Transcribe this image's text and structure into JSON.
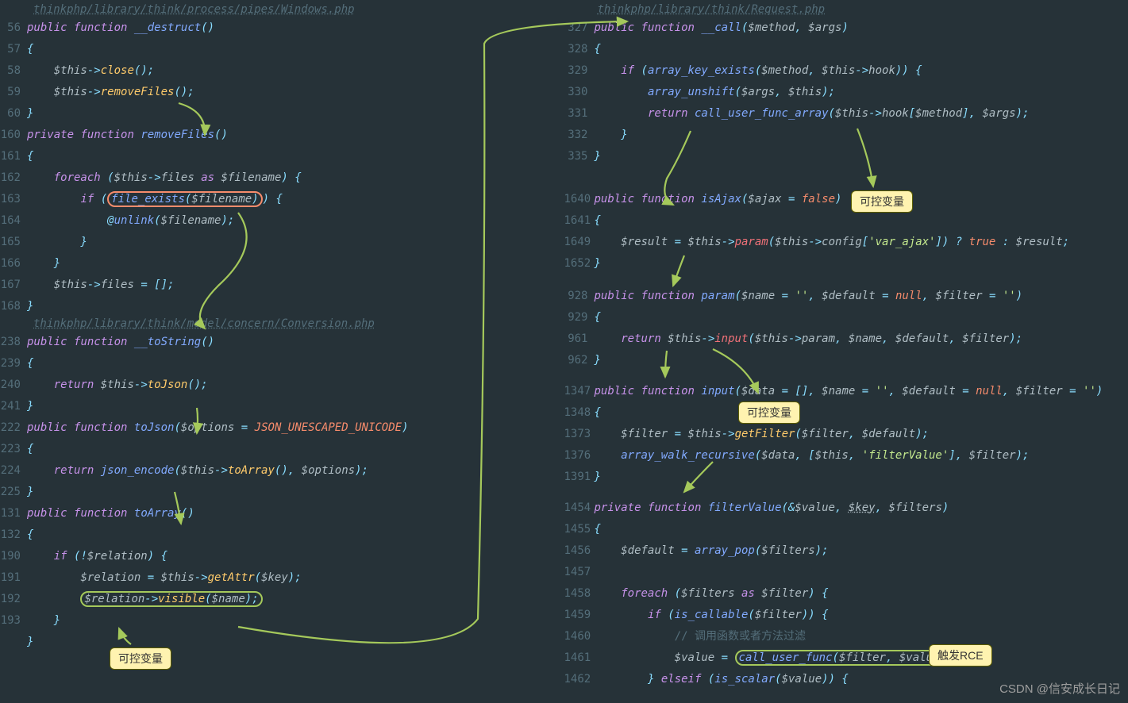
{
  "left": {
    "path1": "thinkphp/library/think/process/pipes/Windows.php",
    "l56": "public function __destruct()",
    "l57": "{",
    "l58": "    $this->close();",
    "l59": "    $this->removeFiles();",
    "l60": "}",
    "l160": "private function removeFiles()",
    "l161": "{",
    "l162": "    foreach ($this->files as $filename) {",
    "l163_pre": "        if (",
    "l163_hl": "file_exists($filename)",
    "l163_post": ") {",
    "l164": "            @unlink($filename);",
    "l165": "        }",
    "l166": "    }",
    "l167": "    $this->files = [];",
    "l168": "}",
    "path2": "thinkphp/library/think/model/concern/Conversion.php",
    "l238": "public function __toString()",
    "l239": "{",
    "l240": "    return $this->toJson();",
    "l241": "}",
    "l222": "public function toJson($options = JSON_UNESCAPED_UNICODE)",
    "l223": "{",
    "l224": "    return json_encode($this->toArray(), $options);",
    "l225": "}",
    "l131": "public function toArray()",
    "l132": "{",
    "l190": "    if (!$relation) {",
    "l191": "        $relation = $this->getAttr($key);",
    "l192_pre": "        ",
    "l192_hl": "$relation->visible($name);",
    "l193": "    }",
    "lend": "}"
  },
  "right": {
    "path": "thinkphp/library/think/Request.php",
    "l327": "public function __call($method, $args)",
    "l328": "{",
    "l329": "    if (array_key_exists($method, $this->hook)) {",
    "l330": "        array_unshift($args, $this);",
    "l331": "        return call_user_func_array($this->hook[$method], $args);",
    "l332": "    }",
    "l335": "}",
    "l1640": "public function isAjax($ajax = false)",
    "l1641": "{",
    "l1649": "    $result = $this->param($this->config['var_ajax']) ? true : $result;",
    "l1652": "}",
    "l928": "public function param($name = '', $default = null, $filter = '')",
    "l929": "{",
    "l961": "    return $this->input($this->param, $name, $default, $filter);",
    "l962": "}",
    "l1347": "public function input($data = [], $name = '', $default = null, $filter = '')",
    "l1348": "{",
    "l1373": "    $filter = $this->getFilter($filter, $default);",
    "l1376": "    array_walk_recursive($data, [$this, 'filterValue'], $filter);",
    "l1391": "}",
    "l1454": "private function filterValue(&$value, $key, $filters)",
    "l1455": "{",
    "l1456": "    $default = array_pop($filters);",
    "l1457": "",
    "l1458": "    foreach ($filters as $filter) {",
    "l1459": "        if (is_callable($filter)) {",
    "l1460": "            // 调用函数或者方法过滤",
    "l1461_pre": "            $value = ",
    "l1461_hl": "call_user_func($filter, $value)",
    "l1461_post": ";",
    "l1462": "        } elseif (is_scalar($value)) {"
  },
  "badges": {
    "b1": "可控变量",
    "b2": "可控变量",
    "b3": "可控变量",
    "b4": "触发RCE"
  },
  "watermark": "CSDN @信安成长日记"
}
